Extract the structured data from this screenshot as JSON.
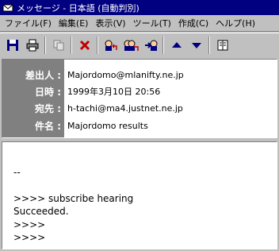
{
  "window": {
    "title": "メッセージ - 日本語 (自動判別)"
  },
  "menubar": {
    "items": [
      {
        "label": "ファイル(F)"
      },
      {
        "label": "編集(E)"
      },
      {
        "label": "表示(V)"
      },
      {
        "label": "ツール(T)"
      },
      {
        "label": "作成(C)"
      },
      {
        "label": "ヘルプ(H)"
      }
    ]
  },
  "toolbar": {
    "buttons": [
      {
        "icon": "save-icon"
      },
      {
        "icon": "print-icon"
      },
      {
        "icon": "copy-icon"
      },
      {
        "icon": "delete-icon"
      },
      {
        "icon": "reply-icon"
      },
      {
        "icon": "reply-all-icon"
      },
      {
        "icon": "forward-icon"
      },
      {
        "icon": "previous-icon"
      },
      {
        "icon": "next-icon"
      },
      {
        "icon": "address-book-icon"
      }
    ]
  },
  "header": {
    "from_label": "差出人 :",
    "from_value": "Majordomo@mlanifty.ne.jp",
    "date_label": "日時 :",
    "date_value": "1999年3月10日 20:56",
    "to_label": "宛先 :",
    "to_value": "h-tachi@ma4.justnet.ne.jp",
    "subject_label": "件名 :",
    "subject_value": "Majordomo results"
  },
  "body": {
    "lines": [
      "",
      "--",
      "",
      ">>>> subscribe hearing",
      "Succeeded.",
      ">>>>",
      ">>>>"
    ]
  },
  "colors": {
    "titlebar": "#000080",
    "label_panel": "#808080",
    "window_bg": "#c0c0c0"
  }
}
